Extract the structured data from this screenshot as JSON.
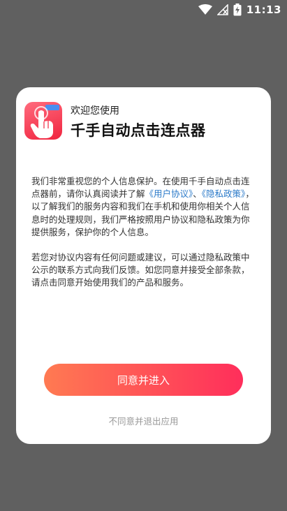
{
  "status_bar": {
    "time": "11:13"
  },
  "dialog": {
    "welcome": "欢迎您使用",
    "app_name": "千手自动点击连点器",
    "para1_a": "我们非常重视您的个人信息保护。在使用千手自动点击连点器前，请你认真阅读并了解",
    "link_user_agreement": "《用户协议》",
    "separator": "、",
    "link_privacy": "《隐私政策》",
    "para1_b": "，以了解我们的服务内容和我们在手机和使用你相关个人信息时的处理规则，我们严格按照用户协议和隐私政策为你提供服务，保护你的个人信息。",
    "para2": "若您对协议内容有任何问题或建议，可以通过隐私政策中公示的联系方式向我们反馈。如您同意并接受全部条款，请点击同意开始使用我们的产品和服务。",
    "agree_button": "同意并进入",
    "decline_link": "不同意并退出应用"
  },
  "colors": {
    "overlay": "#606060",
    "link": "#2b7ac9",
    "button_start": "#ff7a52",
    "button_end": "#ff2e5b"
  },
  "icons": [
    "wifi-icon",
    "no-signal-icon",
    "battery-charging-icon",
    "tap-hand-icon"
  ]
}
